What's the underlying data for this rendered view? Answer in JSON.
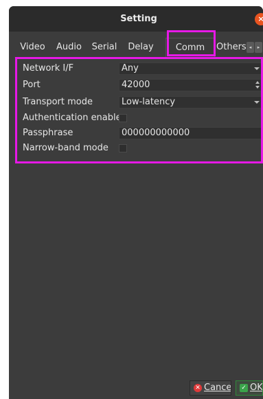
{
  "window": {
    "title": "Setting",
    "close_icon": "close-icon"
  },
  "tabs": [
    {
      "label": "Video",
      "active": false
    },
    {
      "label": "Audio",
      "active": false
    },
    {
      "label": "Serial",
      "active": false
    },
    {
      "label": "Delay",
      "active": false
    },
    {
      "label": "Comm",
      "active": true
    },
    {
      "label": "Others",
      "active": false
    }
  ],
  "tab_scroll": {
    "left": "◂",
    "right": "▸"
  },
  "comm": {
    "network_if": {
      "label": "Network I/F",
      "value": "Any"
    },
    "port": {
      "label": "Port",
      "value": "42000"
    },
    "transport_mode": {
      "label": "Transport mode",
      "value": "Low-latency"
    },
    "authentication": {
      "label": "Authentication enable",
      "checked": false
    },
    "passphrase": {
      "label": "Passphrase",
      "value": "000000000000"
    },
    "narrow_band": {
      "label": "Narrow-band mode",
      "checked": false
    }
  },
  "buttons": {
    "cancel": {
      "label": "Cancel",
      "icon": "cancel-icon"
    },
    "ok": {
      "label": "OK",
      "icon": "check-icon"
    }
  },
  "colors": {
    "highlight": "#e619e6",
    "window_bg": "#3c3c3c",
    "titlebar_bg": "#2b2b2b",
    "close_red": "#e95420"
  }
}
